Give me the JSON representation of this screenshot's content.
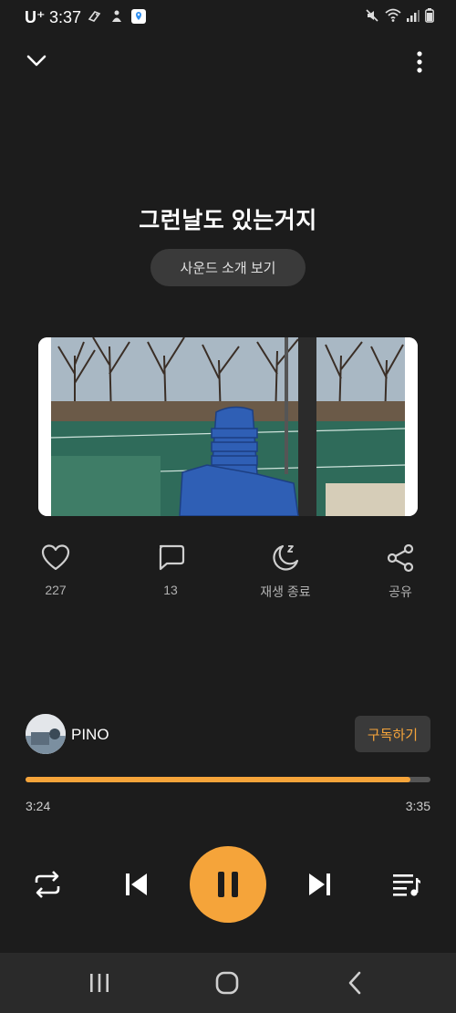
{
  "status_bar": {
    "carrier": "U⁺",
    "time": "3:37",
    "icons": [
      "gamepad-icon",
      "bell-icon",
      "maps-icon",
      "mute-icon",
      "wifi-icon",
      "signal-icon",
      "battery-icon"
    ]
  },
  "header": {
    "collapse_icon": "chevron-down-icon",
    "more_icon": "more-vertical-icon"
  },
  "song": {
    "title": "그런날도 있는거지",
    "sound_intro_label": "사운드 소개 보기"
  },
  "actions": [
    {
      "icon": "heart-icon",
      "label": "227"
    },
    {
      "icon": "comment-icon",
      "label": "13"
    },
    {
      "icon": "sleep-timer-icon",
      "label": "재생 종료"
    },
    {
      "icon": "share-icon",
      "label": "공유"
    }
  ],
  "artist": {
    "name": "PINO",
    "subscribe_label": "구독하기"
  },
  "playback": {
    "elapsed": "3:24",
    "total": "3:35",
    "progress": 0.95
  },
  "controls": {
    "icons": [
      "repeat-icon",
      "previous-icon",
      "pause-icon",
      "next-icon",
      "playlist-icon"
    ]
  },
  "nav": {
    "icons": [
      "recent-apps-icon",
      "home-icon",
      "back-icon"
    ]
  },
  "colors": {
    "background": "#1c1c1c",
    "accent": "#f5a43a",
    "button_bg": "#3a3a3a",
    "track": "#555555"
  }
}
